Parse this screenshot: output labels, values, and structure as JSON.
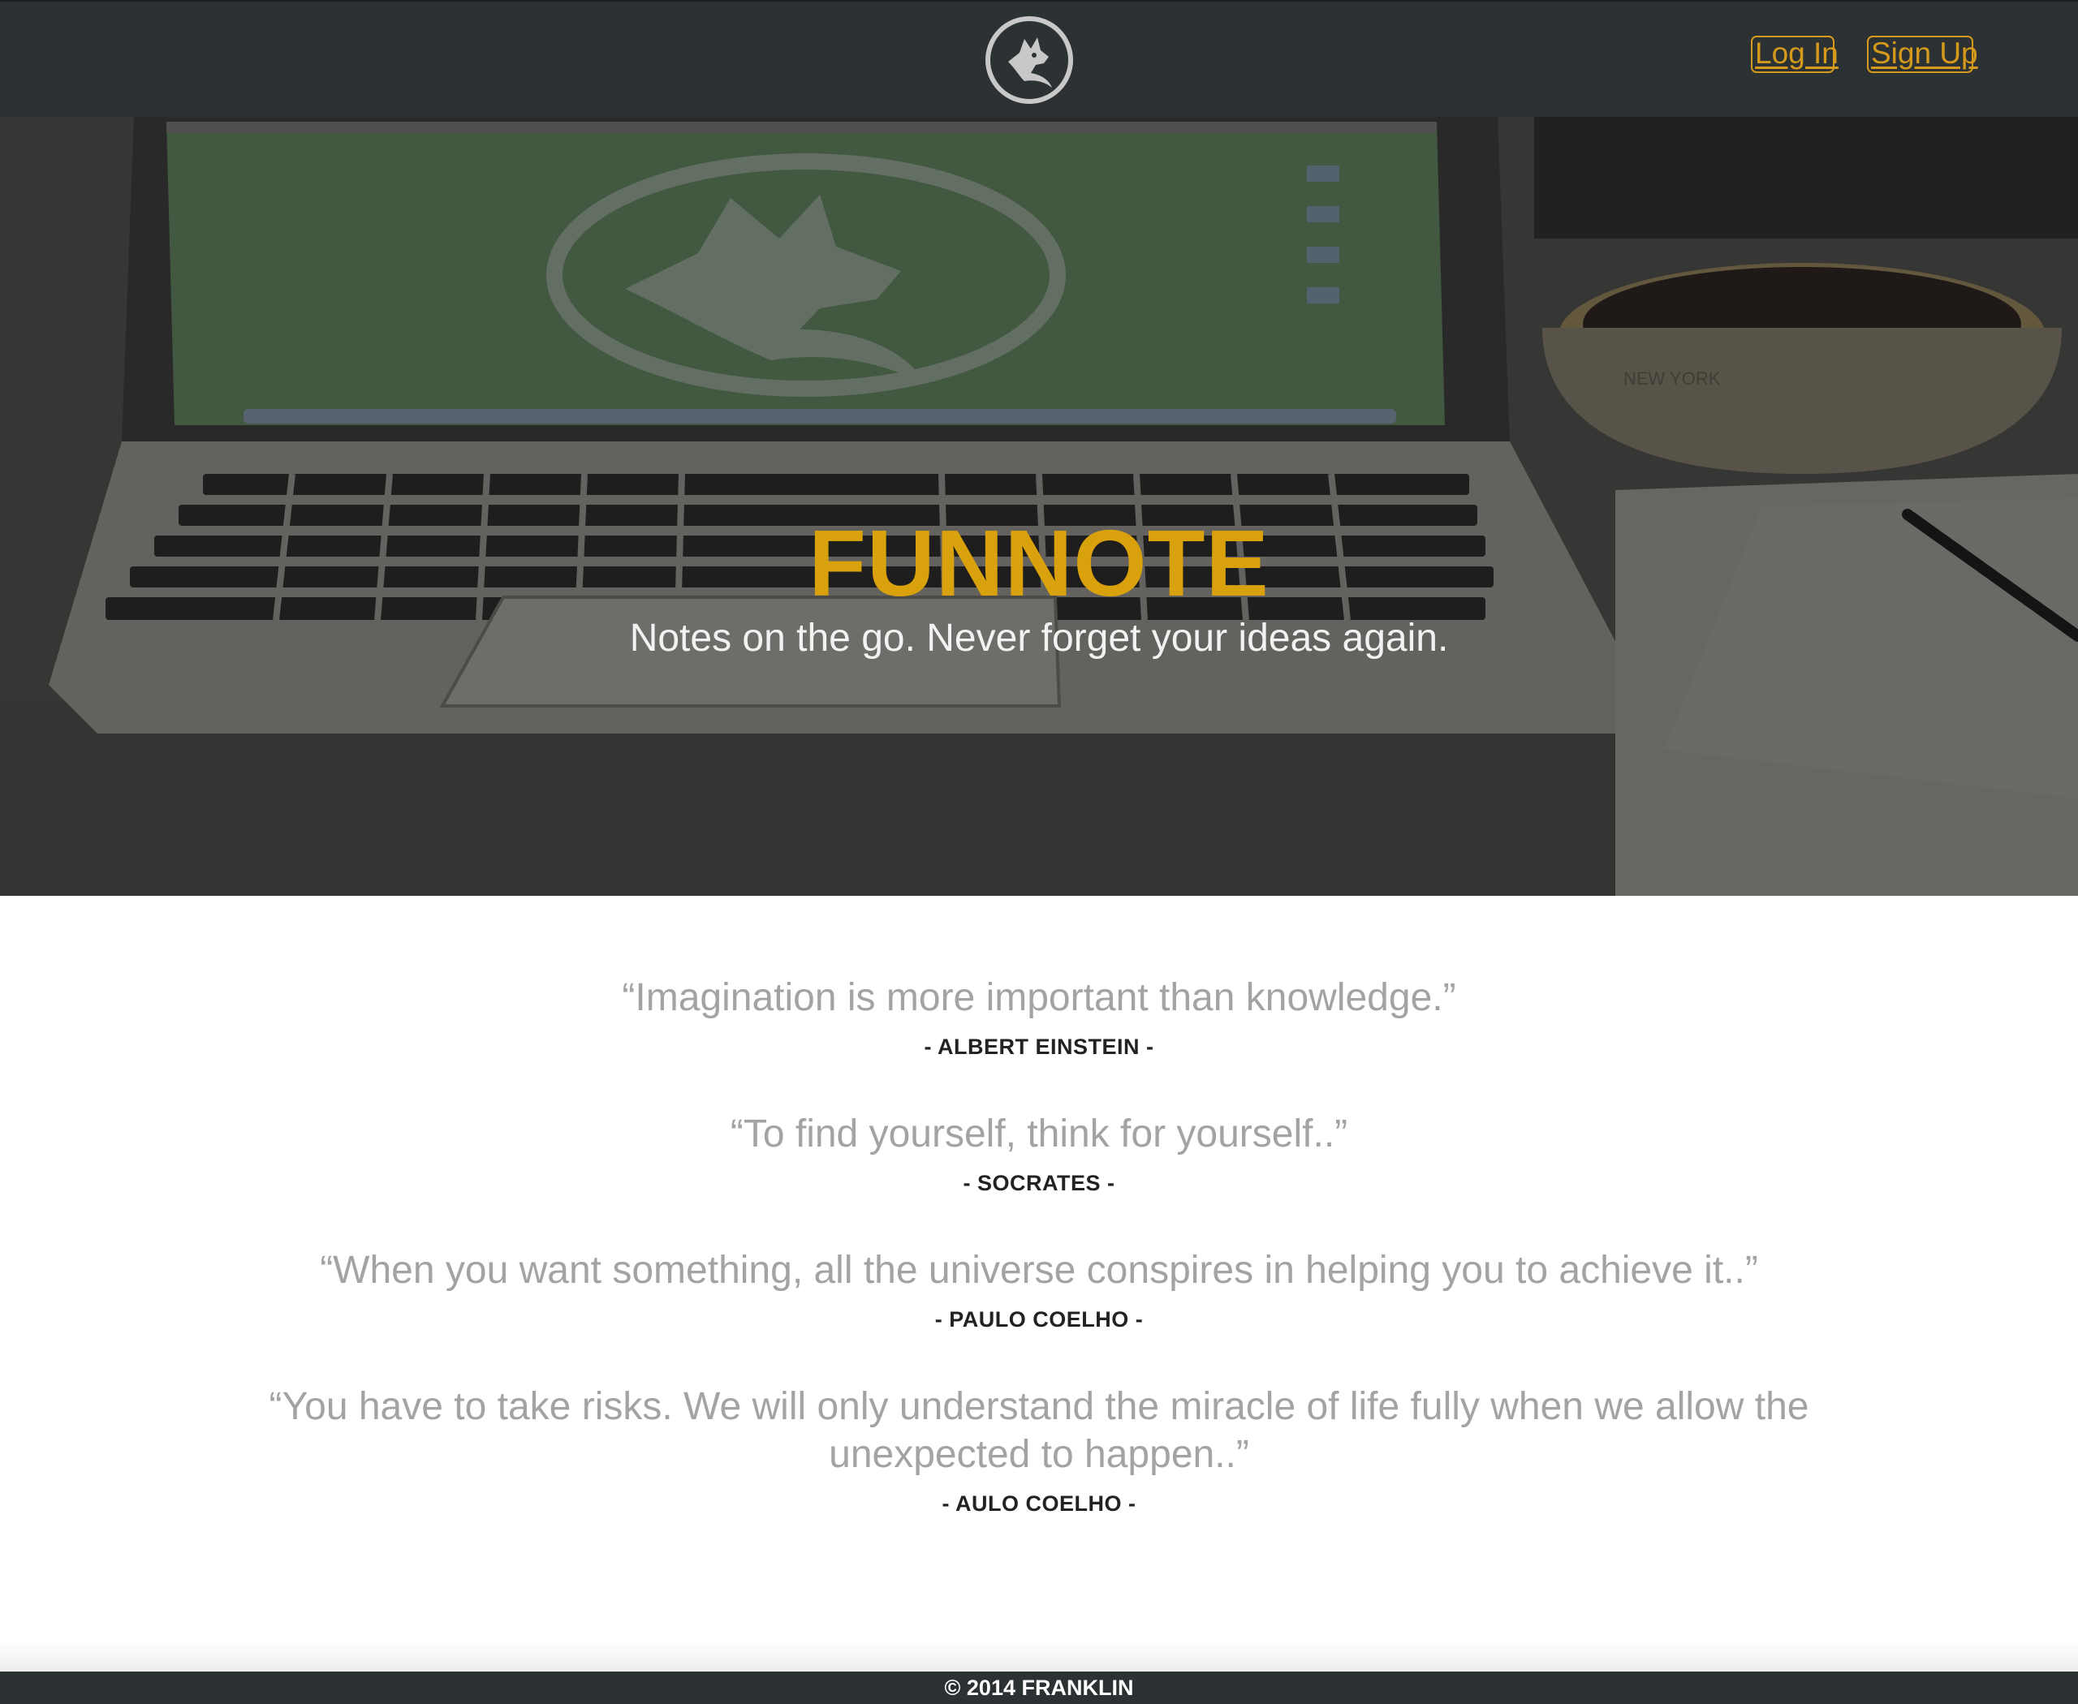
{
  "header": {
    "logo_icon": "fox-logo-icon",
    "login_label": "Log In",
    "signup_label": "Sign Up",
    "accent_color": "#d59a1c",
    "background_color": "#2c3133"
  },
  "hero": {
    "title": "FUNNOTE",
    "subtitle": "Notes on the go. Never forget your ideas again.",
    "background_image": "laptop-and-coffee-photo",
    "title_color": "#d9a10b",
    "cup_text": "NEW YORK"
  },
  "quotes": [
    {
      "text": "“Imagination is more important than knowledge.”",
      "author": "- ALBERT EINSTEIN -"
    },
    {
      "text": "“To find yourself, think for yourself..”",
      "author": "- SOCRATES -"
    },
    {
      "text": "“When you want something, all the universe conspires in helping you to achieve it..”",
      "author": "- PAULO COELHO -"
    },
    {
      "text": "“You have to take risks. We will only understand the miracle of life fully when we allow the unexpected to happen..”",
      "author": "- AULO COELHO -"
    }
  ],
  "footer": {
    "copyright": "© 2014 FRANKLIN"
  }
}
